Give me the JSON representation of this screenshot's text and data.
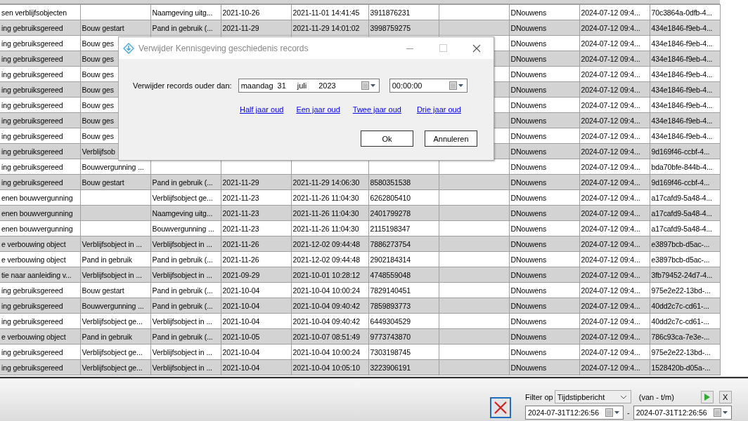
{
  "table": {
    "rows": [
      {
        "cells": [
          "sen verblijfsobjecten",
          null,
          "Naamgeving uitg...",
          "2021-10-26",
          "2021-11-01 14:41:45",
          "3911876231",
          null,
          "DNouwens",
          "2024-07-12 09:4...",
          "70c3864a-0dfb-4..."
        ]
      },
      {
        "cells": [
          "ing gebruiksgereed",
          "Bouw gestart",
          "Pand in gebruik (...",
          "2021-11-29",
          "2021-11-29 14:01:02",
          "3998759275",
          null,
          "DNouwens",
          "2024-07-12 09:4...",
          "434e1846-f9eb-4..."
        ]
      },
      {
        "cells": [
          "ing gebruiksgereed",
          "Bouw ges",
          null,
          null,
          null,
          null,
          null,
          "DNouwens",
          "2024-07-12 09:4...",
          "434e1846-f9eb-4..."
        ]
      },
      {
        "cells": [
          "ing gebruiksgereed",
          "Bouw ges",
          null,
          null,
          null,
          null,
          null,
          "DNouwens",
          "2024-07-12 09:4...",
          "434e1846-f9eb-4..."
        ]
      },
      {
        "cells": [
          "ing gebruiksgereed",
          "Bouw ges",
          null,
          null,
          null,
          null,
          null,
          "DNouwens",
          "2024-07-12 09:4...",
          "434e1846-f9eb-4..."
        ]
      },
      {
        "cells": [
          "ing gebruiksgereed",
          "Bouw ges",
          null,
          null,
          null,
          null,
          null,
          "DNouwens",
          "2024-07-12 09:4...",
          "434e1846-f9eb-4..."
        ]
      },
      {
        "cells": [
          "ing gebruiksgereed",
          "Bouw ges",
          null,
          null,
          null,
          null,
          null,
          "DNouwens",
          "2024-07-12 09:4...",
          "434e1846-f9eb-4..."
        ]
      },
      {
        "cells": [
          "ing gebruiksgereed",
          "Bouw ges",
          null,
          null,
          null,
          null,
          null,
          "DNouwens",
          "2024-07-12 09:4...",
          "434e1846-f9eb-4..."
        ]
      },
      {
        "cells": [
          "ing gebruiksgereed",
          "Bouw ges",
          null,
          null,
          null,
          null,
          null,
          "DNouwens",
          "2024-07-12 09:4...",
          "434e1846-f9eb-4..."
        ]
      },
      {
        "cells": [
          "ing gebruiksgereed",
          "Verblijfsob",
          null,
          null,
          null,
          null,
          null,
          "DNouwens",
          "2024-07-12 09:4...",
          "9d169f46-ccbf-4..."
        ]
      },
      {
        "cells": [
          "ing gebruiksgereed",
          "Bouwvergunning ...",
          null,
          null,
          null,
          null,
          null,
          "DNouwens",
          "2024-07-12 09:4...",
          "bda70bfe-844b-4..."
        ]
      },
      {
        "cells": [
          "ing gebruiksgereed",
          "Bouw gestart",
          "Pand in gebruik (...",
          "2021-11-29",
          "2021-11-29 14:06:30",
          "8580351538",
          null,
          "DNouwens",
          "2024-07-12 09:4...",
          "9d169f46-ccbf-4..."
        ]
      },
      {
        "cells": [
          "enen bouwvergunning",
          null,
          "Verblijfsobject ge...",
          "2021-11-23",
          "2021-11-26 11:04:30",
          "6262805410",
          null,
          "DNouwens",
          "2024-07-12 09:4...",
          "a17cafd9-5a48-4..."
        ]
      },
      {
        "cells": [
          "enen bouwvergunning",
          null,
          "Naamgeving uitg...",
          "2021-11-23",
          "2021-11-26 11:04:30",
          "2401799278",
          null,
          "DNouwens",
          "2024-07-12 09:4...",
          "a17cafd9-5a48-4..."
        ]
      },
      {
        "cells": [
          "enen bouwvergunning",
          null,
          "Bouwvergunning ...",
          "2021-11-23",
          "2021-11-26 11:04:30",
          "2115198347",
          null,
          "DNouwens",
          "2024-07-12 09:4...",
          "a17cafd9-5a48-4..."
        ]
      },
      {
        "cells": [
          "e verbouwing object",
          "Verblijfsobject in ...",
          "Verblijfsobject in ...",
          "2021-11-26",
          "2021-12-02 09:44:48",
          "7886273754",
          null,
          "DNouwens",
          "2024-07-12 09:4...",
          "e3897bcb-d5ac-..."
        ]
      },
      {
        "cells": [
          "e verbouwing object",
          "Pand in gebruik",
          "Pand in gebruik (...",
          "2021-11-26",
          "2021-12-02 09:44:48",
          "2902184314",
          null,
          "DNouwens",
          "2024-07-12 09:4...",
          "e3897bcb-d5ac-..."
        ]
      },
      {
        "cells": [
          "tie naar aanleiding v...",
          "Verblijfsobject in ...",
          "Verblijfsobject in ...",
          "2021-09-29",
          "2021-10-01 10:28:12",
          "4748559048",
          null,
          "DNouwens",
          "2024-07-12 09:4...",
          "3fb79452-24d7-4..."
        ]
      },
      {
        "cells": [
          "ing gebruiksgereed",
          "Bouw gestart",
          "Pand in gebruik (...",
          "2021-10-04",
          "2021-10-04 10:00:24",
          "7829140451",
          null,
          "DNouwens",
          "2024-07-12 09:4...",
          "975e2e22-13bd-..."
        ]
      },
      {
        "cells": [
          "ing gebruiksgereed",
          "Bouwvergunning ...",
          "Pand in gebruik (...",
          "2021-10-04",
          "2021-10-04 09:40:42",
          "7859893773",
          null,
          "DNouwens",
          "2024-07-12 09:4...",
          "40dd2c7c-cd61-..."
        ]
      },
      {
        "cells": [
          "ing gebruiksgereed",
          "Verblijfsobject ge...",
          "Verblijfsobject in ...",
          "2021-10-04",
          "2021-10-04 09:40:42",
          "6449304529",
          null,
          "DNouwens",
          "2024-07-12 09:4...",
          "40dd2c7c-cd61-..."
        ]
      },
      {
        "cells": [
          "e verbouwing object",
          "Pand in gebruik",
          "Pand in gebruik (...",
          "2021-10-05",
          "2021-10-07 08:51:49",
          "9773743870",
          null,
          "DNouwens",
          "2024-07-12 09:4...",
          "786c93ca-7e3e-..."
        ]
      },
      {
        "cells": [
          "ing gebruiksgereed",
          "Verblijfsobject ge...",
          "Verblijfsobject in ...",
          "2021-10-04",
          "2021-10-04 10:00:24",
          "7303198745",
          null,
          "DNouwens",
          "2024-07-12 09:4...",
          "975e2e22-13bd-..."
        ]
      },
      {
        "cells": [
          "ing gebruiksgereed",
          "Verblijfsobject ge...",
          "Verblijfsobject in ...",
          "2021-10-04",
          "2021-10-04 10:05:10",
          "3223906191",
          null,
          "DNouwens",
          "2024-07-12 09:4...",
          "1528420b-d05a-..."
        ]
      }
    ]
  },
  "dialog": {
    "title": "Verwijder Kennisgeving geschiedenis records",
    "date_label": "Verwijder records ouder dan:",
    "date_field": {
      "weekday": "maandag",
      "day": "31",
      "month": "juli",
      "year": "2023"
    },
    "time_field": {
      "value": "00:00:00"
    },
    "links": [
      "Half jaar oud",
      "Een jaar oud",
      "Twee jaar oud",
      "Drie jaar oud"
    ],
    "buttons": [
      "Ok",
      "Annuleren"
    ]
  },
  "filter_bar": {
    "label": "Filter op",
    "select": {
      "value": "Tijdstipbericht"
    },
    "range_label": "(van - t/m)",
    "from": {
      "value": "2024-07-31T12:26:56"
    },
    "separator": "-",
    "to": {
      "value": "2024-07-31T12:26:56"
    },
    "clear_button": "X"
  }
}
